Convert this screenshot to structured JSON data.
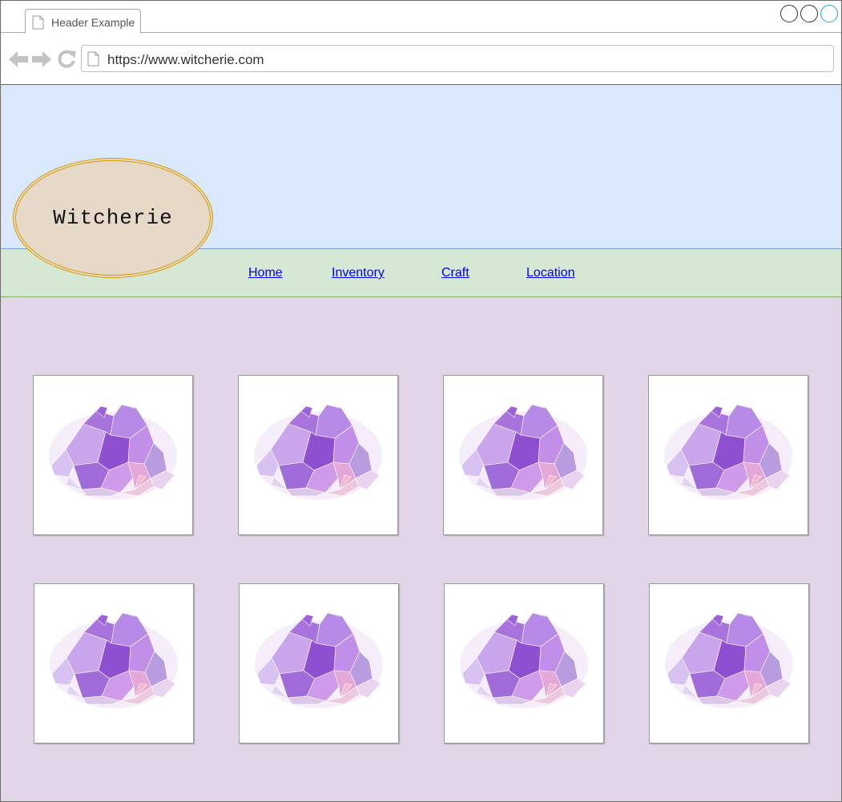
{
  "browser": {
    "tab_title": "Header Example",
    "url": "https://www.witcherie.com",
    "icons": {
      "tab": "page-icon",
      "back": "arrow-left-icon",
      "forward": "arrow-right-icon",
      "reload": "reload-icon",
      "url": "page-icon"
    }
  },
  "logo": {
    "text": "Witcherie"
  },
  "menu": {
    "items": [
      {
        "label": "Home"
      },
      {
        "label": "Inventory"
      },
      {
        "label": "Craft"
      },
      {
        "label": "Location"
      }
    ]
  },
  "gallery": {
    "image_subject": "amethyst-crystal-cluster",
    "count": 8
  },
  "colors": {
    "header_band": "#dae8fc",
    "menu_band": "#d5e8d4",
    "content_band": "#e1d5e7",
    "logo_fill": "#e6d9c7",
    "logo_border": "#d79b00",
    "link": "#0000ee"
  }
}
